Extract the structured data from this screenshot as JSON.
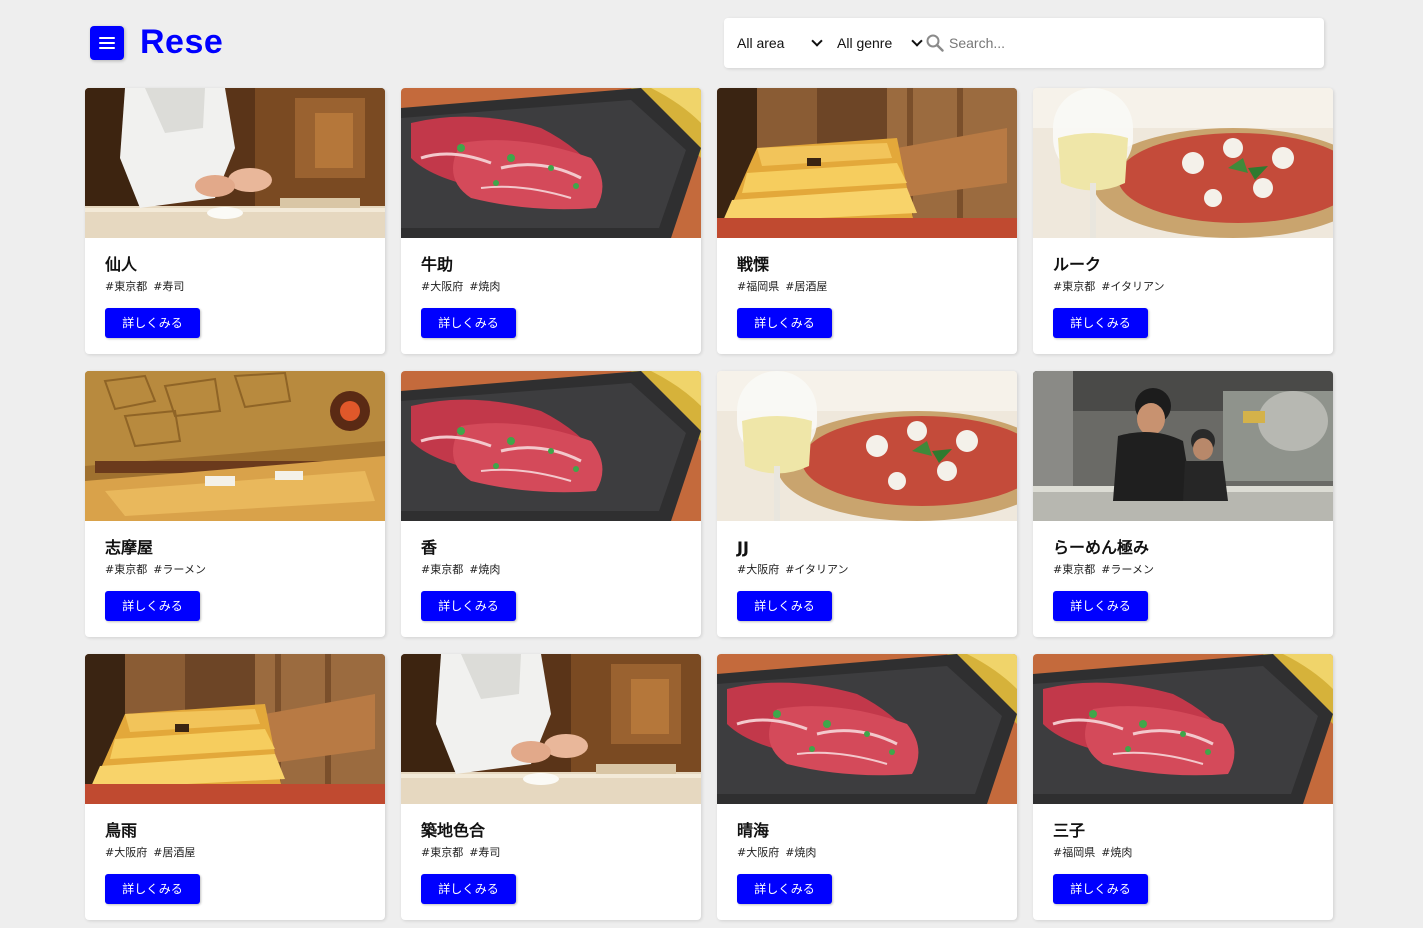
{
  "header": {
    "logo": "Rese",
    "menu_icon": "hamburger-menu-icon"
  },
  "search": {
    "area_value": "All area",
    "genre_value": "All genre",
    "placeholder": "Search...",
    "search_icon": "magnifier-icon"
  },
  "detail_label": "詳しくみる",
  "colors": {
    "brand": "#0000ff",
    "background": "#eeeeee",
    "card": "#ffffff"
  },
  "shops": [
    {
      "name": "仙人",
      "area": "#東京都",
      "genre": "#寿司",
      "image": "sushi"
    },
    {
      "name": "牛助",
      "area": "#大阪府",
      "genre": "#焼肉",
      "image": "yakiniku"
    },
    {
      "name": "戦慄",
      "area": "#福岡県",
      "genre": "#居酒屋",
      "image": "izakaya"
    },
    {
      "name": "ルーク",
      "area": "#東京都",
      "genre": "#イタリアン",
      "image": "italian"
    },
    {
      "name": "志摩屋",
      "area": "#東京都",
      "genre": "#ラーメン",
      "image": "izakaya-dining"
    },
    {
      "name": "香",
      "area": "#東京都",
      "genre": "#焼肉",
      "image": "yakiniku"
    },
    {
      "name": "JJ",
      "area": "#大阪府",
      "genre": "#イタリアン",
      "image": "italian"
    },
    {
      "name": "らーめん極み",
      "area": "#東京都",
      "genre": "#ラーメン",
      "image": "ramen"
    },
    {
      "name": "鳥雨",
      "area": "#大阪府",
      "genre": "#居酒屋",
      "image": "izakaya"
    },
    {
      "name": "築地色合",
      "area": "#東京都",
      "genre": "#寿司",
      "image": "sushi"
    },
    {
      "name": "晴海",
      "area": "#大阪府",
      "genre": "#焼肉",
      "image": "yakiniku"
    },
    {
      "name": "三子",
      "area": "#福岡県",
      "genre": "#焼肉",
      "image": "yakiniku"
    }
  ]
}
